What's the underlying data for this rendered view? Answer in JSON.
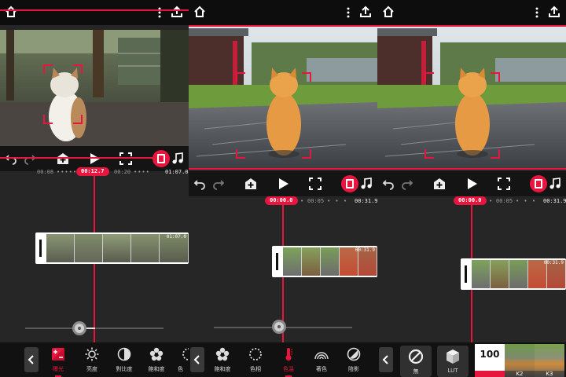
{
  "colors": {
    "accent": "#e8163f",
    "panel_bg": "#262626",
    "topbar_bg": "#0d0d0d"
  },
  "icons": [
    "home-icon",
    "more-vertical-icon",
    "share-icon",
    "undo-icon",
    "redo-icon",
    "add-layer-icon",
    "play-icon",
    "fullscreen-icon",
    "film-icon",
    "music-icon",
    "chevron-left-icon"
  ],
  "panels": [
    {
      "playhead": "00:12.7",
      "tc_left": "00:08",
      "tc_mid": "00:20",
      "tc_end": "01:07.0",
      "clip_duration": "01:07.0",
      "zoom_level": 0.39,
      "tools": [
        {
          "label": "曝光",
          "icon": "exposure-icon",
          "active": true
        },
        {
          "label": "亮度",
          "icon": "brightness-icon",
          "active": false
        },
        {
          "label": "對比度",
          "icon": "contrast-icon",
          "active": false
        },
        {
          "label": "飽和度",
          "icon": "saturation-icon",
          "active": false
        },
        {
          "label": "色",
          "icon": "hue-icon",
          "active": false
        }
      ]
    },
    {
      "playhead": "00:00.0",
      "tc_mid": "00:05",
      "tc_end": "00:31.9",
      "clip_duration": "00:31.9",
      "zoom_level": 0.47,
      "tools": [
        {
          "label": "飽和度",
          "icon": "saturation-icon",
          "active": false
        },
        {
          "label": "色相",
          "icon": "hue-icon",
          "active": false
        },
        {
          "label": "色溫",
          "icon": "temperature-icon",
          "active": true
        },
        {
          "label": "著色",
          "icon": "tint-icon",
          "active": false
        },
        {
          "label": "陰影",
          "icon": "shadow-icon",
          "active": false
        }
      ]
    },
    {
      "playhead": "00:00.0",
      "tc_mid": "00:05",
      "tc_end": "00:31.9",
      "clip_duration": "00:31.9",
      "filters": [
        {
          "label": "無",
          "icon": "none-icon"
        },
        {
          "label": "LUT",
          "icon": "cube-icon"
        }
      ],
      "luts": [
        {
          "label": "K1",
          "value": "100",
          "selected": true
        },
        {
          "label": "K2",
          "selected": false
        },
        {
          "label": "K3",
          "selected": false
        }
      ]
    }
  ]
}
